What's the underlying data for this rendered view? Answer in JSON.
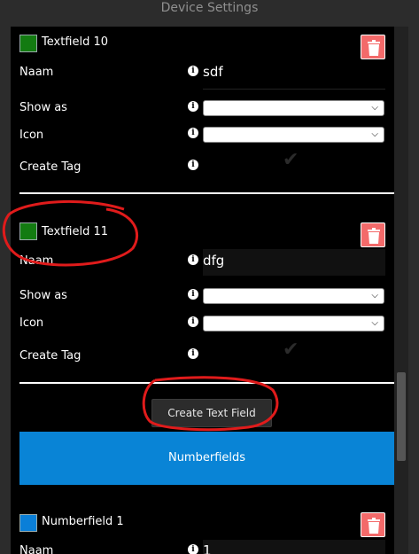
{
  "header": {
    "title": "Device Settings"
  },
  "textfields": [
    {
      "title": "Textfield 10",
      "fields": {
        "naam_label": "Naam",
        "naam_value": "sdf",
        "show_as_label": "Show as",
        "icon_label": "Icon",
        "create_tag_label": "Create Tag"
      }
    },
    {
      "title": "Textfield 11",
      "fields": {
        "naam_label": "Naam",
        "naam_value": "dfg",
        "show_as_label": "Show as",
        "icon_label": "Icon",
        "create_tag_label": "Create Tag"
      }
    }
  ],
  "create_button": {
    "label": "Create Text Field"
  },
  "numberfields_section": {
    "label": "Numberfields"
  },
  "numberfields": [
    {
      "title": "Numberfield 1",
      "fields": {
        "naam_label": "Naam",
        "naam_value": "1"
      }
    }
  ],
  "icons": {
    "info": "info-icon",
    "trash": "trash-icon",
    "check": "check-icon",
    "chevron": "chevron-down-icon"
  },
  "colors": {
    "textfield_swatch": "#137b11",
    "numberfield_swatch": "#0a7fd8",
    "delete_button": "#f36a6a",
    "section_bar": "#0984d6",
    "annotation": "#e01b1b"
  }
}
